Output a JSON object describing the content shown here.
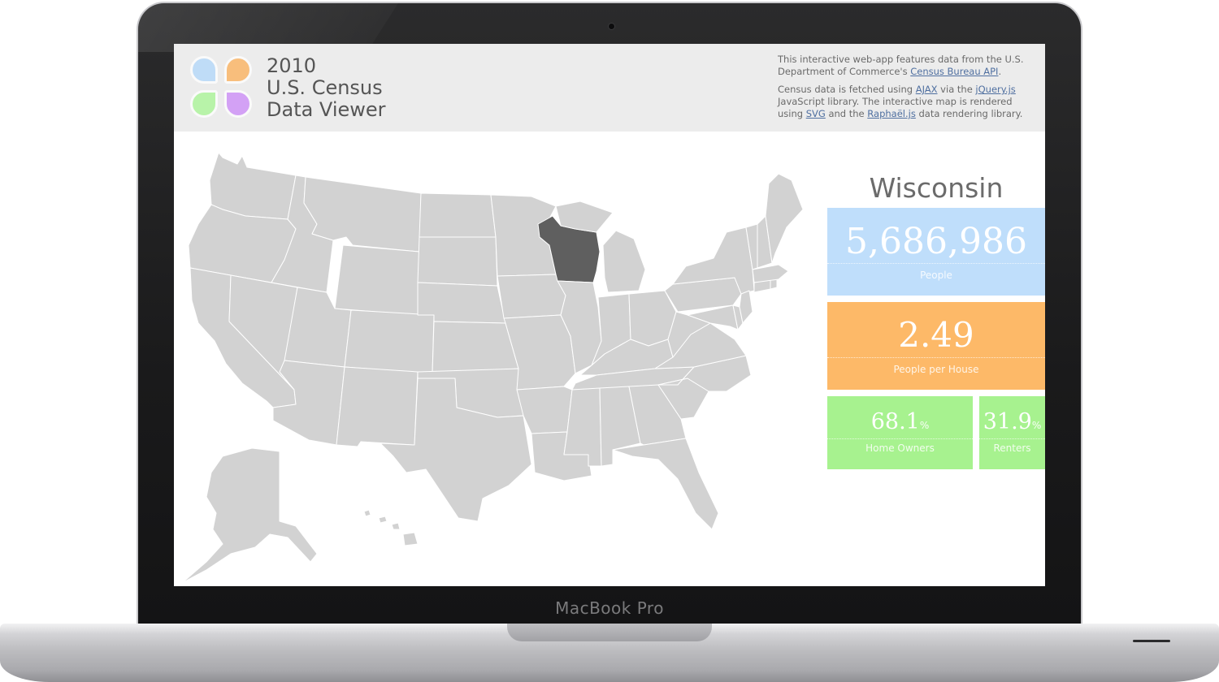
{
  "device": {
    "label": "MacBook Pro"
  },
  "header": {
    "title_lines": [
      "2010",
      "U.S. Census",
      "Data Viewer"
    ],
    "about": {
      "p1_prefix": "This interactive web-app features data from the U.S. Department of Commerce's ",
      "p1_link": "Census Bureau API",
      "p1_suffix": ".",
      "p2_a": "Census data is fetched using ",
      "p2_link1": "AJAX",
      "p2_b": " via the ",
      "p2_link2": "jQuery.js",
      "p2_c": " JavaScript library. The interactive map is rendered using ",
      "p2_link3": "SVG",
      "p2_d": " and the ",
      "p2_link4": "Raphaël.js",
      "p2_e": " data rendering library."
    }
  },
  "map": {
    "selected_state": "Wisconsin",
    "default_fill": "#d2d2d2",
    "selected_fill": "#5f5f5f"
  },
  "stats": {
    "state": "Wisconsin",
    "people": {
      "value": "5,686,986",
      "label": "People"
    },
    "people_per_house": {
      "value": "2.49",
      "label": "People per House"
    },
    "home_owners": {
      "value": "68.1",
      "unit": "%",
      "label": "Home Owners"
    },
    "renters": {
      "value": "31.9",
      "unit": "%",
      "label": "Renters"
    }
  },
  "colors": {
    "people": "#bfdefb",
    "people_per_house": "#fdb968",
    "ownership": "#a7f28f",
    "logo": [
      "#bfdcf7",
      "#f8be7c",
      "#b8f3a9",
      "#d3a1f5"
    ]
  }
}
